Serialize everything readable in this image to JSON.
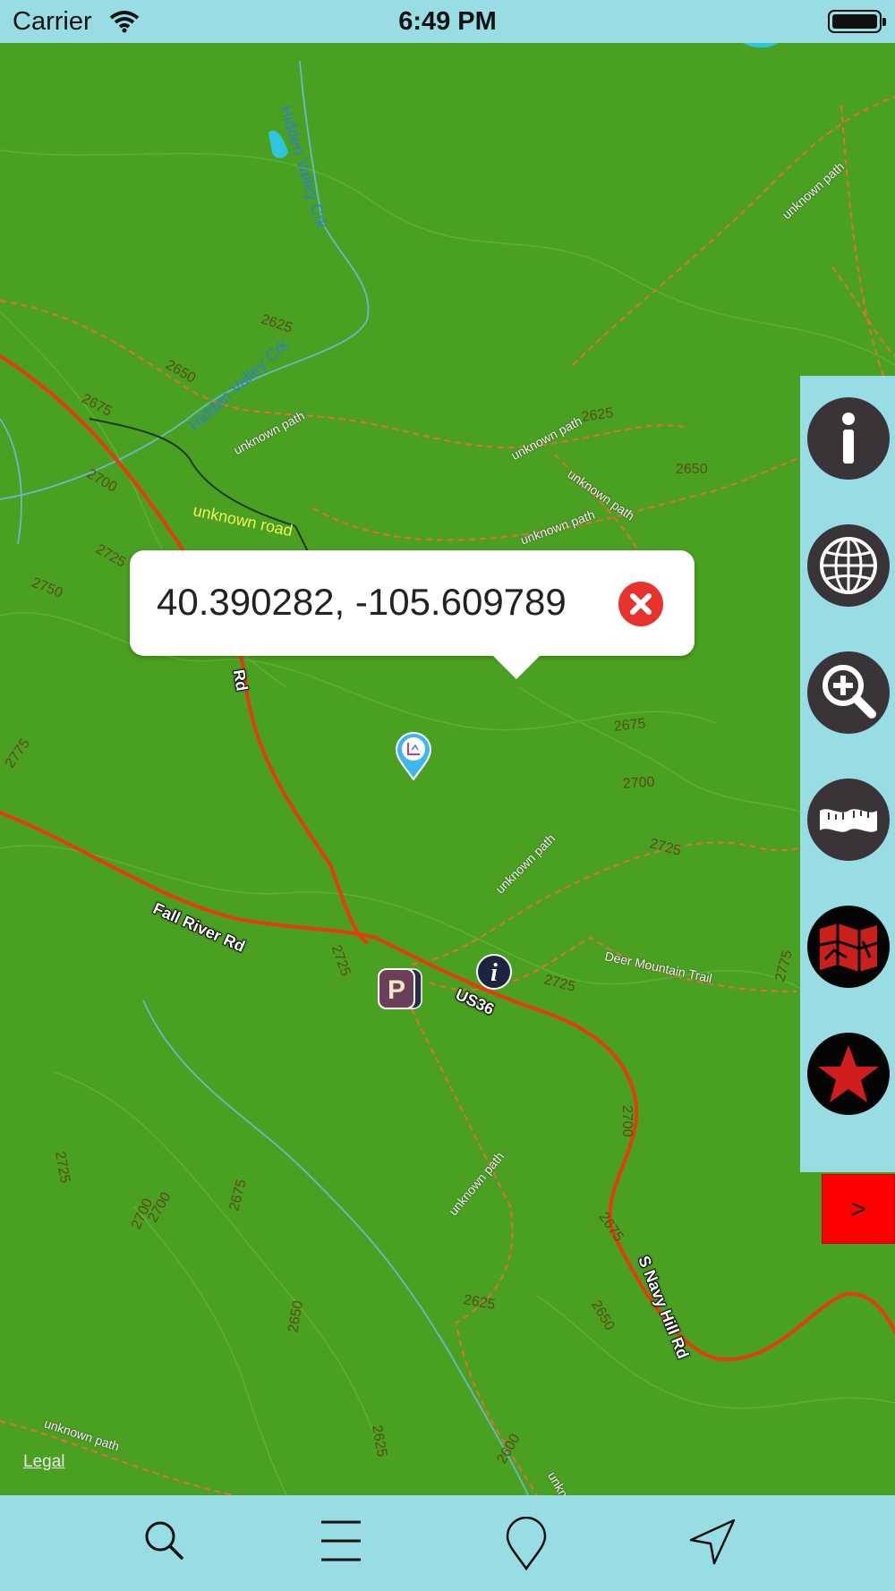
{
  "status_bar": {
    "carrier": "Carrier",
    "time": "6:49 PM"
  },
  "map": {
    "legal": "Legal",
    "contour_labels": [
      "2625",
      "2650",
      "2675",
      "2700",
      "2725",
      "2750",
      "2625",
      "2650",
      "2675",
      "2700",
      "2725",
      "2775",
      "2725",
      "2700",
      "2725",
      "2775",
      "2700",
      "2725",
      "2700",
      "2675",
      "2650",
      "2625",
      "2675",
      "2650",
      "2625",
      "2600"
    ],
    "path_labels": [
      "unknown path",
      "unknown path",
      "unknown path",
      "unknown path",
      "unknown path",
      "unknown path",
      "unknown path",
      "unknown path",
      "unknown path",
      "unkno"
    ],
    "road_labels": [
      "Fall River Rd",
      "US36",
      "S Navy Hill Rd",
      "Rd"
    ],
    "water_labels": [
      "Hidden Valley Crk",
      "Hidden Valley Crk"
    ],
    "other_labels": {
      "unknown_road": "unknown road",
      "trail": "Deer Mountain Trail"
    }
  },
  "popup": {
    "coordinates": "40.390282, -105.609789"
  },
  "pois": {
    "parking": "P",
    "info": "i"
  },
  "side_panel": {
    "buttons": [
      "info-icon",
      "globe-icon",
      "zoom-in-icon",
      "measure-tape-icon",
      "map-layers-icon",
      "star-icon"
    ],
    "expand_label": ">"
  },
  "tab_bar": {
    "tabs": [
      "search-icon",
      "menu-icon",
      "pin-icon",
      "navigation-icon"
    ]
  },
  "colors": {
    "map_bg": "#4aa020",
    "bars": "#97dde3",
    "road": "#e63b0e",
    "accent": "#e8322e"
  }
}
